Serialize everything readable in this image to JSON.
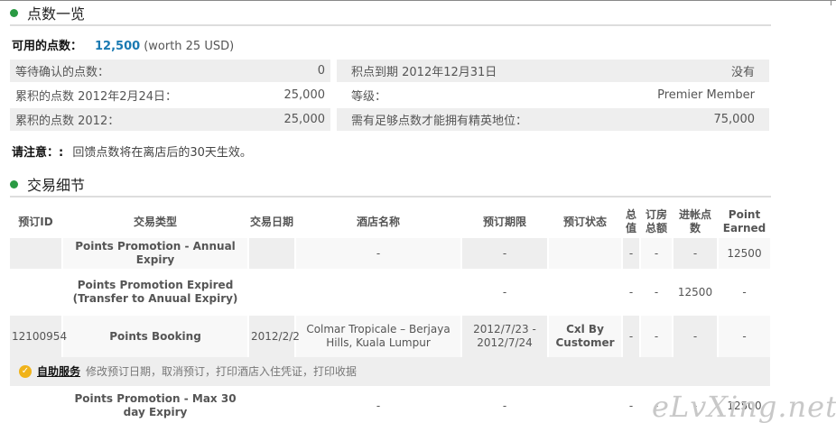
{
  "points_overview": {
    "title": "点数一览",
    "available": {
      "label": "可用的点数：",
      "value": "12,500",
      "worth": "(worth 25 USD)"
    },
    "left_rows": [
      {
        "label": "等待确认的点数：",
        "value": "0"
      },
      {
        "label": "累积的点数  2012年2月24日：",
        "value": "25,000"
      },
      {
        "label": "累积的点数  2012：",
        "value": "25,000"
      }
    ],
    "right_rows": [
      {
        "label": "积点到期 2012年12月31日",
        "value": "没有"
      },
      {
        "label": "等级：",
        "value": "Premier Member"
      },
      {
        "label": "需有足够点数才能拥有精英地位：",
        "value": "75,000"
      }
    ],
    "notice_label": "请注意：:",
    "notice_text": "回馈点数将在离店后的30天生效。"
  },
  "transactions": {
    "title": "交易细节",
    "headers": [
      "预订ID",
      "交易类型",
      "交易日期",
      "酒店名称",
      "预订期限",
      "预订状态",
      "总值",
      "订房总额",
      "进帐点数",
      "Point Earned"
    ],
    "rows": [
      [
        "",
        "Points Promotion - Annual Expiry",
        "",
        "-",
        "-",
        "",
        "-",
        "-",
        "-",
        "12500"
      ],
      [
        "",
        "Points Promotion Expired (Transfer to Anuual Expiry)",
        "",
        "",
        "-",
        "",
        "-",
        "-",
        "12500",
        "-"
      ],
      [
        "12100954",
        "Points Booking",
        "2012/2/2",
        "Colmar Tropicale – Berjaya Hills, Kuala Lumpur",
        "2012/7/23 - 2012/7/24",
        "Cxl By Customer",
        "-",
        "-",
        "-",
        "-"
      ],
      [
        "",
        "Points Promotion - Max 30 day Expiry",
        "",
        "-",
        "-",
        "",
        "-",
        "-",
        "-",
        "12500"
      ]
    ],
    "self_service": {
      "link": "自助服务",
      "text": "修改预订日期，取消预订，打印酒店入住凭证，打印收据"
    }
  },
  "watermark": "eLvXing.net",
  "colors": {
    "accent_green": "#2a9a43",
    "points_blue": "#1a7ab2",
    "row_gray": "#eeeeee",
    "check_orange": "#f0b31a"
  }
}
